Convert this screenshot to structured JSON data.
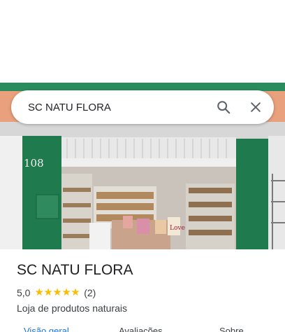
{
  "search": {
    "query": "SC NATU FLORA"
  },
  "storefront": {
    "number": "108",
    "sign_text": "Love"
  },
  "place": {
    "name": "SC NATU FLORA",
    "rating": "5,0",
    "stars": 5,
    "reviews": "(2)",
    "category": "Loja de produtos naturais"
  },
  "tabs": [
    {
      "label": "Visão geral"
    },
    {
      "label": "Avaliações"
    },
    {
      "label": "Sobre"
    }
  ],
  "colors": {
    "star": "#fbbc04",
    "accent": "#1a73e8",
    "storefront_green": "#1f7a4d"
  }
}
